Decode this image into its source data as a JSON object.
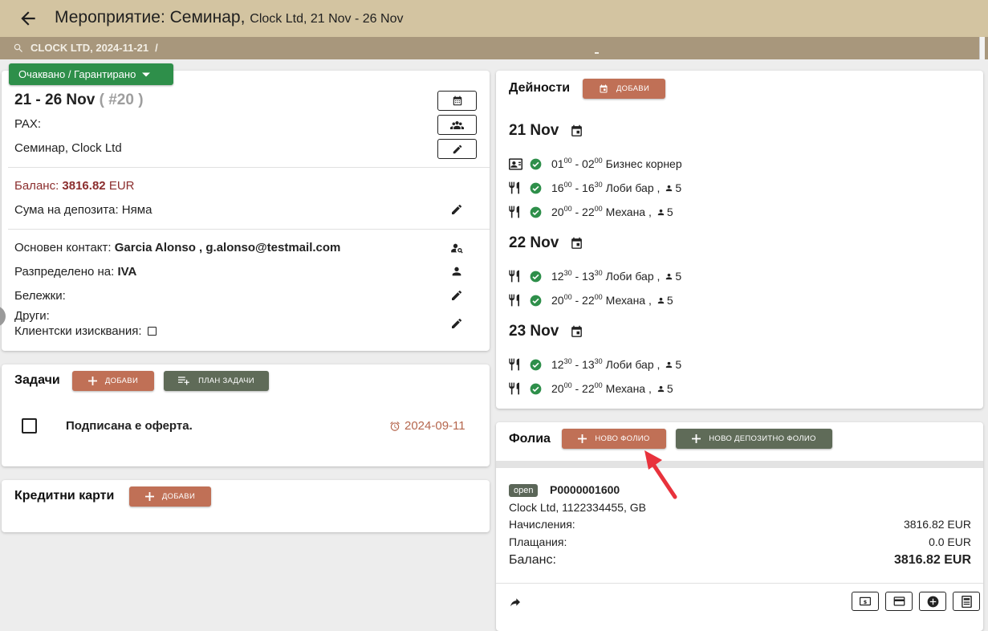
{
  "header": {
    "title": "Мероприятие: Семинар,",
    "subtitle": "Clock Ltd, 21 Nov - 26 Nov",
    "breadcrumb": "CLOCK LTD, 2024-11-21",
    "breadcrumb_sep": "/"
  },
  "event": {
    "status": "Очаквано / Гарантирано",
    "dates": "21 - 26 Nov",
    "number": "( #20 )",
    "pax_label": "PAX:",
    "name": "Семинар, Clock Ltd",
    "balance_label": "Баланс:",
    "balance_value": "3816.82",
    "balance_currency": "EUR",
    "deposit": "Сума на депозита: Няма",
    "contact_label": "Основен контакт:",
    "contact_value": "Garcia Alonso , g.alonso@testmail.com",
    "assigned_label": "Разпределено на:",
    "assigned_value": "IVA",
    "notes_label": "Бележки:",
    "other_label": "Други:",
    "requirements_label": "Клиентски изисквания:"
  },
  "tasks": {
    "title": "Задачи",
    "add": "ДОБАВИ",
    "plan": "ПЛАН ЗАДАЧИ",
    "items": [
      {
        "label": "Подписана е оферта.",
        "date": "2024-09-11"
      }
    ]
  },
  "cards": {
    "title": "Кредитни карти",
    "add": "ДОБАВИ"
  },
  "activities": {
    "title": "Дейности",
    "add": "ДОБАВИ",
    "days": [
      {
        "label": "21 Nov",
        "items": [
          {
            "icon": "contact-card-icon",
            "start_h": "01",
            "start_m": "00",
            "end_h": "02",
            "end_m": "00",
            "place": "Бизнес корнер",
            "pax": ""
          },
          {
            "icon": "restaurant-icon",
            "start_h": "16",
            "start_m": "00",
            "end_h": "16",
            "end_m": "30",
            "place": "Лоби бар ,",
            "pax": "5"
          },
          {
            "icon": "restaurant-icon",
            "start_h": "20",
            "start_m": "00",
            "end_h": "22",
            "end_m": "00",
            "place": "Механа ,",
            "pax": "5"
          }
        ]
      },
      {
        "label": "22 Nov",
        "items": [
          {
            "icon": "restaurant-icon",
            "start_h": "12",
            "start_m": "30",
            "end_h": "13",
            "end_m": "30",
            "place": "Лоби бар ,",
            "pax": "5"
          },
          {
            "icon": "restaurant-icon",
            "start_h": "20",
            "start_m": "00",
            "end_h": "22",
            "end_m": "00",
            "place": "Механа ,",
            "pax": "5"
          }
        ]
      },
      {
        "label": "23 Nov",
        "items": [
          {
            "icon": "restaurant-icon",
            "start_h": "12",
            "start_m": "30",
            "end_h": "13",
            "end_m": "30",
            "place": "Лоби бар ,",
            "pax": "5"
          },
          {
            "icon": "restaurant-icon",
            "start_h": "20",
            "start_m": "00",
            "end_h": "22",
            "end_m": "00",
            "place": "Механа ,",
            "pax": "5"
          }
        ]
      }
    ]
  },
  "folios": {
    "title": "Фолиа",
    "new_folio": "НОВО ФОЛИО",
    "new_deposit_folio": "НОВО ДЕПОЗИТНО ФОЛИО",
    "folio": {
      "status": "open",
      "number": "P0000001600",
      "client": "Clock Ltd, 1122334455, GB",
      "charges_label": "Начисления:",
      "charges_value": "3816.82 EUR",
      "payments_label": "Плащания:",
      "payments_value": "0.0 EUR",
      "balance_label": "Баланс:",
      "balance_value": "3816.82 EUR"
    }
  },
  "colors": {
    "header_bg": "#d3c4a1",
    "breadcrumb_bg": "#a8977c",
    "status_green": "#2e8f4a",
    "button_red": "#c07056",
    "button_green": "#5f6b58",
    "balance_red": "#8b2e2e",
    "check_green": "#2e8f4a",
    "arrow_red": "#e8323c"
  }
}
